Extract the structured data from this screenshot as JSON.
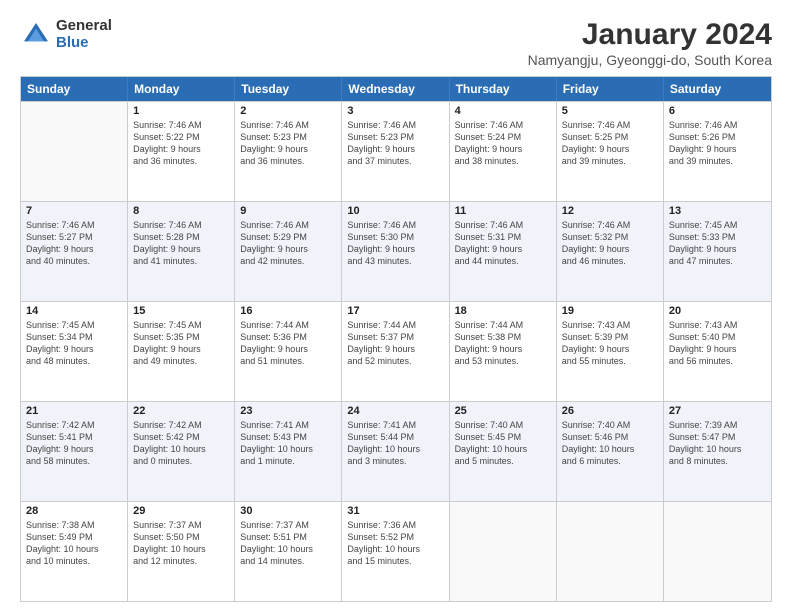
{
  "logo": {
    "general": "General",
    "blue": "Blue"
  },
  "title": "January 2024",
  "location": "Namyangju, Gyeonggi-do, South Korea",
  "header_days": [
    "Sunday",
    "Monday",
    "Tuesday",
    "Wednesday",
    "Thursday",
    "Friday",
    "Saturday"
  ],
  "weeks": [
    [
      {
        "day": "",
        "info": ""
      },
      {
        "day": "1",
        "info": "Sunrise: 7:46 AM\nSunset: 5:22 PM\nDaylight: 9 hours\nand 36 minutes."
      },
      {
        "day": "2",
        "info": "Sunrise: 7:46 AM\nSunset: 5:23 PM\nDaylight: 9 hours\nand 36 minutes."
      },
      {
        "day": "3",
        "info": "Sunrise: 7:46 AM\nSunset: 5:23 PM\nDaylight: 9 hours\nand 37 minutes."
      },
      {
        "day": "4",
        "info": "Sunrise: 7:46 AM\nSunset: 5:24 PM\nDaylight: 9 hours\nand 38 minutes."
      },
      {
        "day": "5",
        "info": "Sunrise: 7:46 AM\nSunset: 5:25 PM\nDaylight: 9 hours\nand 39 minutes."
      },
      {
        "day": "6",
        "info": "Sunrise: 7:46 AM\nSunset: 5:26 PM\nDaylight: 9 hours\nand 39 minutes."
      }
    ],
    [
      {
        "day": "7",
        "info": "Sunrise: 7:46 AM\nSunset: 5:27 PM\nDaylight: 9 hours\nand 40 minutes."
      },
      {
        "day": "8",
        "info": "Sunrise: 7:46 AM\nSunset: 5:28 PM\nDaylight: 9 hours\nand 41 minutes."
      },
      {
        "day": "9",
        "info": "Sunrise: 7:46 AM\nSunset: 5:29 PM\nDaylight: 9 hours\nand 42 minutes."
      },
      {
        "day": "10",
        "info": "Sunrise: 7:46 AM\nSunset: 5:30 PM\nDaylight: 9 hours\nand 43 minutes."
      },
      {
        "day": "11",
        "info": "Sunrise: 7:46 AM\nSunset: 5:31 PM\nDaylight: 9 hours\nand 44 minutes."
      },
      {
        "day": "12",
        "info": "Sunrise: 7:46 AM\nSunset: 5:32 PM\nDaylight: 9 hours\nand 46 minutes."
      },
      {
        "day": "13",
        "info": "Sunrise: 7:45 AM\nSunset: 5:33 PM\nDaylight: 9 hours\nand 47 minutes."
      }
    ],
    [
      {
        "day": "14",
        "info": "Sunrise: 7:45 AM\nSunset: 5:34 PM\nDaylight: 9 hours\nand 48 minutes."
      },
      {
        "day": "15",
        "info": "Sunrise: 7:45 AM\nSunset: 5:35 PM\nDaylight: 9 hours\nand 49 minutes."
      },
      {
        "day": "16",
        "info": "Sunrise: 7:44 AM\nSunset: 5:36 PM\nDaylight: 9 hours\nand 51 minutes."
      },
      {
        "day": "17",
        "info": "Sunrise: 7:44 AM\nSunset: 5:37 PM\nDaylight: 9 hours\nand 52 minutes."
      },
      {
        "day": "18",
        "info": "Sunrise: 7:44 AM\nSunset: 5:38 PM\nDaylight: 9 hours\nand 53 minutes."
      },
      {
        "day": "19",
        "info": "Sunrise: 7:43 AM\nSunset: 5:39 PM\nDaylight: 9 hours\nand 55 minutes."
      },
      {
        "day": "20",
        "info": "Sunrise: 7:43 AM\nSunset: 5:40 PM\nDaylight: 9 hours\nand 56 minutes."
      }
    ],
    [
      {
        "day": "21",
        "info": "Sunrise: 7:42 AM\nSunset: 5:41 PM\nDaylight: 9 hours\nand 58 minutes."
      },
      {
        "day": "22",
        "info": "Sunrise: 7:42 AM\nSunset: 5:42 PM\nDaylight: 10 hours\nand 0 minutes."
      },
      {
        "day": "23",
        "info": "Sunrise: 7:41 AM\nSunset: 5:43 PM\nDaylight: 10 hours\nand 1 minute."
      },
      {
        "day": "24",
        "info": "Sunrise: 7:41 AM\nSunset: 5:44 PM\nDaylight: 10 hours\nand 3 minutes."
      },
      {
        "day": "25",
        "info": "Sunrise: 7:40 AM\nSunset: 5:45 PM\nDaylight: 10 hours\nand 5 minutes."
      },
      {
        "day": "26",
        "info": "Sunrise: 7:40 AM\nSunset: 5:46 PM\nDaylight: 10 hours\nand 6 minutes."
      },
      {
        "day": "27",
        "info": "Sunrise: 7:39 AM\nSunset: 5:47 PM\nDaylight: 10 hours\nand 8 minutes."
      }
    ],
    [
      {
        "day": "28",
        "info": "Sunrise: 7:38 AM\nSunset: 5:49 PM\nDaylight: 10 hours\nand 10 minutes."
      },
      {
        "day": "29",
        "info": "Sunrise: 7:37 AM\nSunset: 5:50 PM\nDaylight: 10 hours\nand 12 minutes."
      },
      {
        "day": "30",
        "info": "Sunrise: 7:37 AM\nSunset: 5:51 PM\nDaylight: 10 hours\nand 14 minutes."
      },
      {
        "day": "31",
        "info": "Sunrise: 7:36 AM\nSunset: 5:52 PM\nDaylight: 10 hours\nand 15 minutes."
      },
      {
        "day": "",
        "info": ""
      },
      {
        "day": "",
        "info": ""
      },
      {
        "day": "",
        "info": ""
      }
    ]
  ]
}
